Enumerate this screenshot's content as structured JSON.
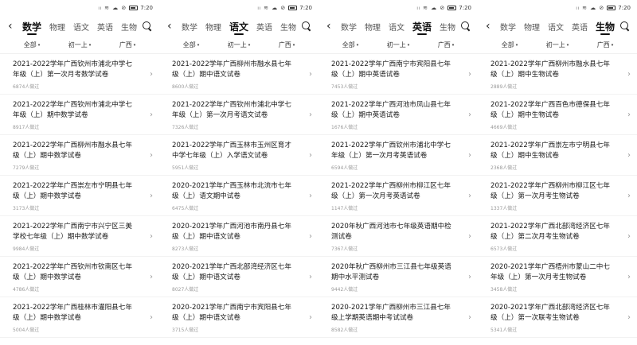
{
  "status_bar": {
    "time": "7:20",
    "icons": "ₗₗ ≋ ☁ ⊘"
  },
  "filter_caret": "▾",
  "panels": [
    {
      "active_tab": 0,
      "tabs": [
        "数学",
        "物理",
        "语文",
        "英语",
        "生物"
      ],
      "filters": [
        "全部",
        "初一上",
        "广西"
      ],
      "items": [
        {
          "title": "2021-2022学年广西钦州市浦北中学七年级（上）第一次月考数学试卷",
          "views": "6874人做过"
        },
        {
          "title": "2021-2022学年广西钦州市浦北中学七年级（上）期中数学试卷",
          "views": "8917人做过"
        },
        {
          "title": "2021-2022学年广西柳州市融水县七年级（上）期中数学试卷",
          "views": "7279人做过"
        },
        {
          "title": "2021-2022学年广西崇左市宁明县七年级（上）期中数学试卷",
          "views": "3173人做过"
        },
        {
          "title": "2021-2022学年广西南宁市兴宁区三美学校七年级（上）期中数学试卷",
          "views": "9984人做过"
        },
        {
          "title": "2021-2022学年广西钦州市钦南区七年级（上）期中数学试卷",
          "views": "4786人做过"
        },
        {
          "title": "2021-2022学年广西桂林市灌阳县七年级（上）期中数学试卷",
          "views": "5004人做过"
        }
      ]
    },
    {
      "active_tab": 2,
      "tabs": [
        "数学",
        "物理",
        "语文",
        "英语",
        "生物"
      ],
      "filters": [
        "全部",
        "初一上",
        "广西"
      ],
      "items": [
        {
          "title": "2021-2022学年广西柳州市融水县七年级（上）期中语文试卷",
          "views": "8600人做过"
        },
        {
          "title": "2021-2022学年广西钦州市浦北中学七年级（上）第一次月考语文试卷",
          "views": "7326人做过"
        },
        {
          "title": "2021-2022学年广西玉林市玉州区育才中学七年级（上）入学语文试卷",
          "views": "5951人做过"
        },
        {
          "title": "2020-2021学年广西玉林市北流市七年级（上）语文期中试卷",
          "views": "6475人做过"
        },
        {
          "title": "2020-2021学年广西河池市南丹县七年级（上）期中语文试卷",
          "views": "8273人做过"
        },
        {
          "title": "2020-2021学年广西北部湾经济区七年级（上）期中语文试卷",
          "views": "8027人做过"
        },
        {
          "title": "2020-2021学年广西南宁市宾阳县七年级（上）期中语文试卷",
          "views": "3715人做过"
        }
      ]
    },
    {
      "active_tab": 3,
      "tabs": [
        "数学",
        "物理",
        "语文",
        "英语",
        "生物"
      ],
      "filters": [
        "全部",
        "初一上",
        "广西"
      ],
      "items": [
        {
          "title": "2021-2022学年广西南宁市宾阳县七年级（上）期中英语试卷",
          "views": "7453人做过"
        },
        {
          "title": "2021-2022学年广西河池市凤山县七年级（上）期中英语试卷",
          "views": "1676人做过"
        },
        {
          "title": "2021-2022学年广西钦州市浦北中学七年级（上）第一次月考英语试卷",
          "views": "6594人做过"
        },
        {
          "title": "2021-2022学年广西柳州市柳江区七年级（上）第一次月考英语试卷",
          "views": "1147人做过"
        },
        {
          "title": "2020年秋广西河池市七年级英语期中检测试卷",
          "views": "7367人做过"
        },
        {
          "title": "2020年秋广西柳州市三江县七年级英语期中水平测试卷",
          "views": "9442人做过"
        },
        {
          "title": "2020-2021学年广西柳州市三江县七年级上学期英语期中考试试卷",
          "views": "8582人做过"
        }
      ]
    },
    {
      "active_tab": 4,
      "tabs": [
        "数学",
        "物理",
        "语文",
        "英语",
        "生物"
      ],
      "filters": [
        "全部",
        "初一上",
        "广西"
      ],
      "items": [
        {
          "title": "2021-2022学年广西柳州市融水县七年级（上）期中生物试卷",
          "views": "2889人做过"
        },
        {
          "title": "2021-2022学年广西百色市德保县七年级（上）期中生物试卷",
          "views": "4669人做过"
        },
        {
          "title": "2021-2022学年广西崇左市宁明县七年级（上）期中生物试卷",
          "views": "2368人做过"
        },
        {
          "title": "2021-2022学年广西柳州市柳江区七年级（上）第一次月考生物试卷",
          "views": "1337人做过"
        },
        {
          "title": "2021-2022学年广西北部湾经济区七年级（上）第二次月考生物试卷",
          "views": "6573人做过"
        },
        {
          "title": "2020-2021学年广西梧州市蒙山二中七年级（上）第一次月考生物试卷",
          "views": "3458人做过"
        },
        {
          "title": "2020-2021学年广西北部湾经济区七年级（上）第一次联考生物试卷",
          "views": "5341人做过"
        }
      ]
    }
  ]
}
